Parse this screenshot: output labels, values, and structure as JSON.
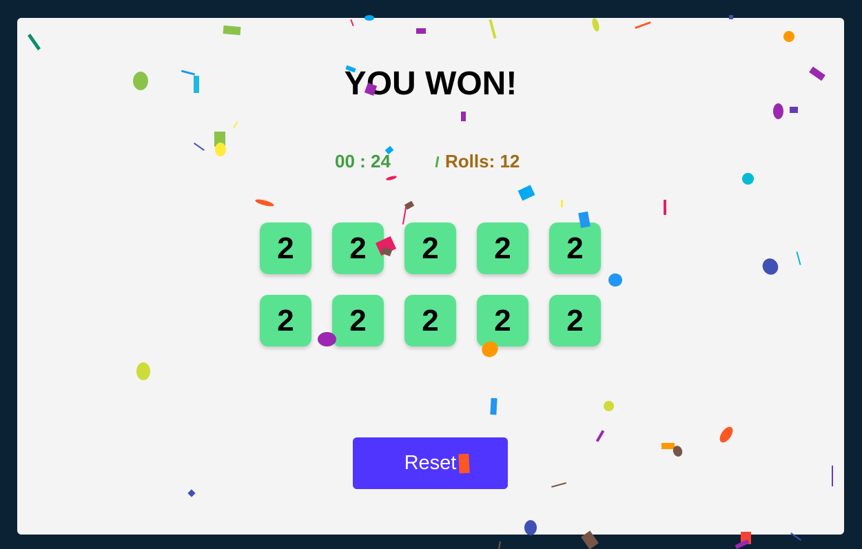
{
  "game": {
    "title": "YOU WON!",
    "timer": "00 : 24",
    "rolls": "Rolls: 12",
    "dice": [
      "2",
      "2",
      "2",
      "2",
      "2",
      "2",
      "2",
      "2",
      "2",
      "2"
    ],
    "die_color": "#59e391",
    "reset_label": "Reset"
  },
  "colors": {
    "page_background": "#0b2235",
    "card_background": "#f4f4f4",
    "timer": "#3f9e3f",
    "rolls": "#a06a14",
    "button": "#5035ff"
  }
}
